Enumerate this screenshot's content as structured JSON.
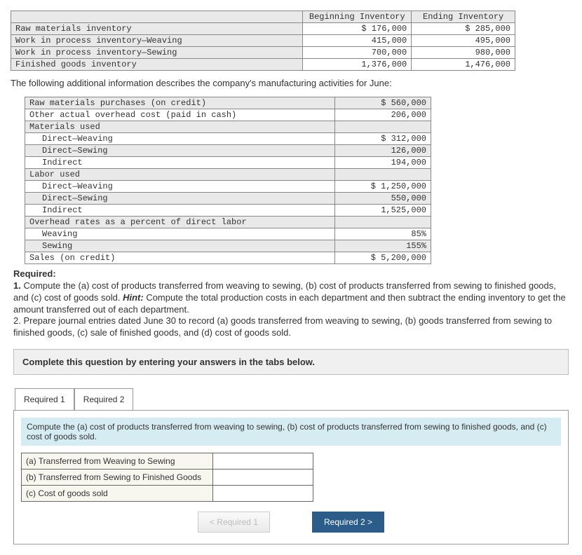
{
  "inventory_table": {
    "headers": [
      "Beginning Inventory",
      "Ending Inventory"
    ],
    "rows": [
      {
        "label": "Raw materials inventory",
        "beg": "$ 176,000",
        "end": "$ 285,000"
      },
      {
        "label": "Work in process inventory—Weaving",
        "beg": "415,000",
        "end": "495,000"
      },
      {
        "label": "Work in process inventory—Sewing",
        "beg": "700,000",
        "end": "980,000"
      },
      {
        "label": "Finished goods inventory",
        "beg": "1,376,000",
        "end": "1,476,000"
      }
    ]
  },
  "narrative1": "The following additional information describes the company's manufacturing activities for June:",
  "activities": [
    {
      "label": "Raw materials purchases (on credit)",
      "val": "$ 560,000",
      "alt": true,
      "indent": 0
    },
    {
      "label": "Other actual overhead cost (paid in cash)",
      "val": "206,000",
      "alt": false,
      "indent": 0
    },
    {
      "label": "Materials used",
      "val": "",
      "alt": true,
      "indent": 0
    },
    {
      "label": "Direct—Weaving",
      "val": "$ 312,000",
      "alt": false,
      "indent": 1
    },
    {
      "label": "Direct—Sewing",
      "val": "126,000",
      "alt": true,
      "indent": 1
    },
    {
      "label": "Indirect",
      "val": "194,000",
      "alt": false,
      "indent": 1
    },
    {
      "label": "Labor used",
      "val": "",
      "alt": true,
      "indent": 0
    },
    {
      "label": "Direct—Weaving",
      "val": "$ 1,250,000",
      "alt": false,
      "indent": 1
    },
    {
      "label": "Direct—Sewing",
      "val": "550,000",
      "alt": true,
      "indent": 1
    },
    {
      "label": "Indirect",
      "val": "1,525,000",
      "alt": false,
      "indent": 1
    },
    {
      "label": "Overhead rates as a percent of direct labor",
      "val": "",
      "alt": true,
      "indent": 0
    },
    {
      "label": "Weaving",
      "val": "85%",
      "alt": false,
      "indent": 1
    },
    {
      "label": "Sewing",
      "val": "155%",
      "alt": true,
      "indent": 1
    },
    {
      "label": "Sales (on credit)",
      "val": "$ 5,200,000",
      "alt": false,
      "indent": 0
    }
  ],
  "required": {
    "heading": "Required:",
    "item1_lead": "1. ",
    "item1_text": "Compute the (a) cost of products transferred from weaving to sewing, (b) cost of products transferred from sewing to finished goods, and (c) cost of goods sold. ",
    "item1_hint_label": "Hint:",
    "item1_hint_text": " Compute the total production costs in each department and then subtract the ending inventory to get the amount transferred out of each department.",
    "item2": "2. Prepare journal entries dated June 30 to record (a) goods transferred from weaving to sewing, (b) goods transferred from sewing to finished goods, (c) sale of finished goods, and (d) cost of goods sold."
  },
  "complete_bar": "Complete this question by entering your answers in the tabs below.",
  "tabs": {
    "t1": "Required 1",
    "t2": "Required 2"
  },
  "tab1": {
    "instr": "Compute the (a) cost of products transferred from weaving to sewing, (b) cost of products transferred from sewing to finished goods, and (c) cost of goods sold.",
    "rows": [
      "(a) Transferred from Weaving to Sewing",
      "(b) Transferred from Sewing to Finished Goods",
      "(c) Cost of goods sold"
    ]
  },
  "nav": {
    "prev": "Required 1",
    "next": "Required 2"
  }
}
